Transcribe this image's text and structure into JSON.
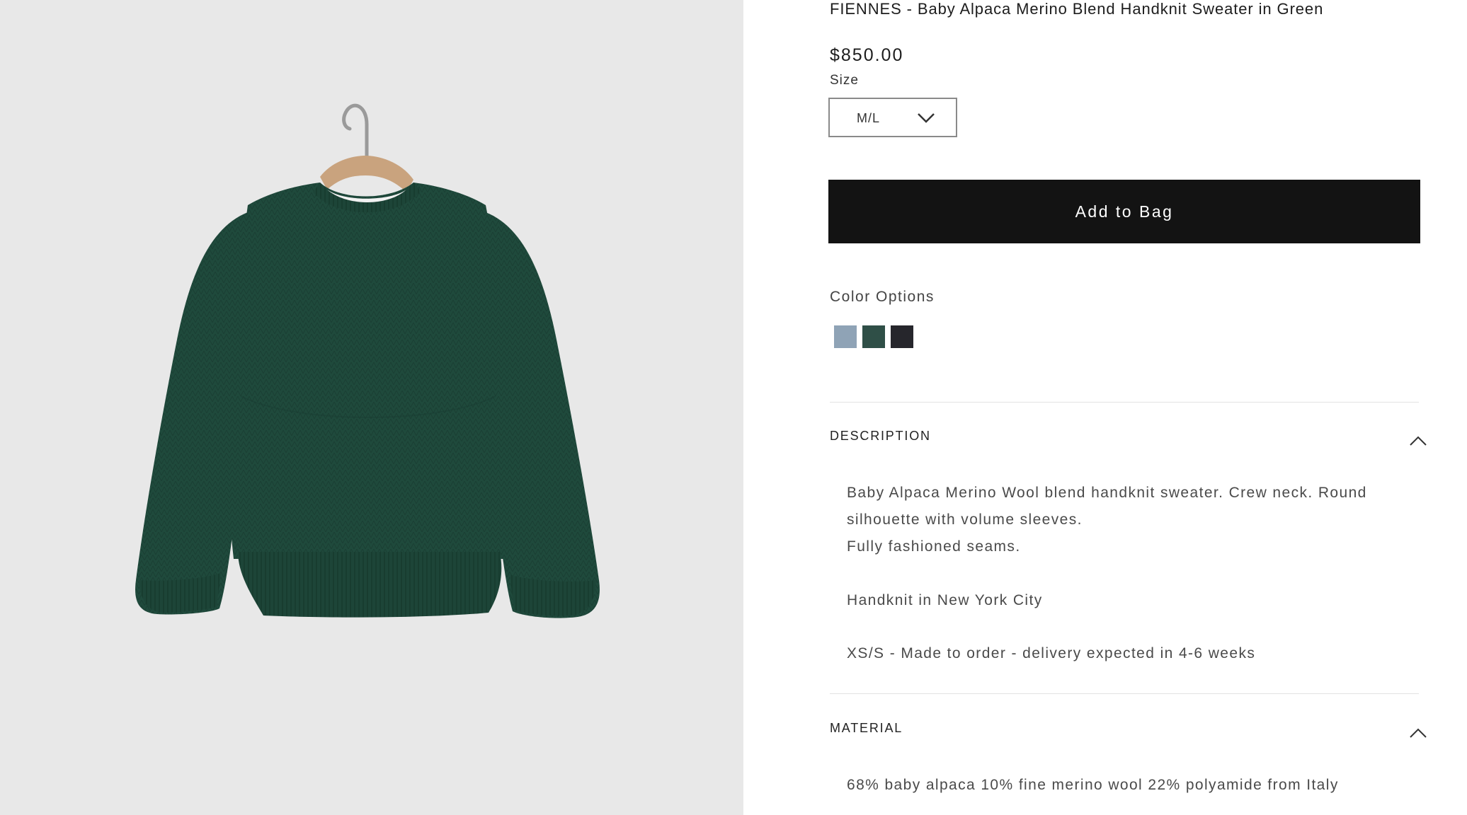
{
  "product": {
    "title": "FIENNES - Baby Alpaca Merino Blend Handknit Sweater in Green",
    "price": "$850.00",
    "image_alt": "Green handknit crew neck sweater on a wooden hanger"
  },
  "size": {
    "label": "Size",
    "selected": "M/L",
    "icon": "chevron-down-icon"
  },
  "add_to_bag": {
    "label": "Add to Bag"
  },
  "colors": {
    "label": "Color Options",
    "options": [
      {
        "name": "Blue",
        "hex": "#8fa3b6"
      },
      {
        "name": "Green",
        "hex": "#2f4f47"
      },
      {
        "name": "Black",
        "hex": "#26262c"
      }
    ]
  },
  "description": {
    "title": "DESCRIPTION",
    "icon": "chevron-up-icon",
    "lines": [
      "Baby Alpaca Merino Wool blend handknit sweater. Crew neck. Round",
      "silhouette with volume sleeves.",
      "Fully fashioned seams.",
      "Handknit in New York City",
      "XS/S - Made to order - delivery expected in 4-6 weeks"
    ]
  },
  "material": {
    "title": "MATERIAL",
    "icon": "chevron-up-icon",
    "text": "68% baby alpaca 10% fine merino wool 22% polyamide from Italy"
  },
  "theme": {
    "image_bg": "#e8e8e8",
    "sweater_green": "#1f4a3c",
    "button_bg": "#131313"
  }
}
